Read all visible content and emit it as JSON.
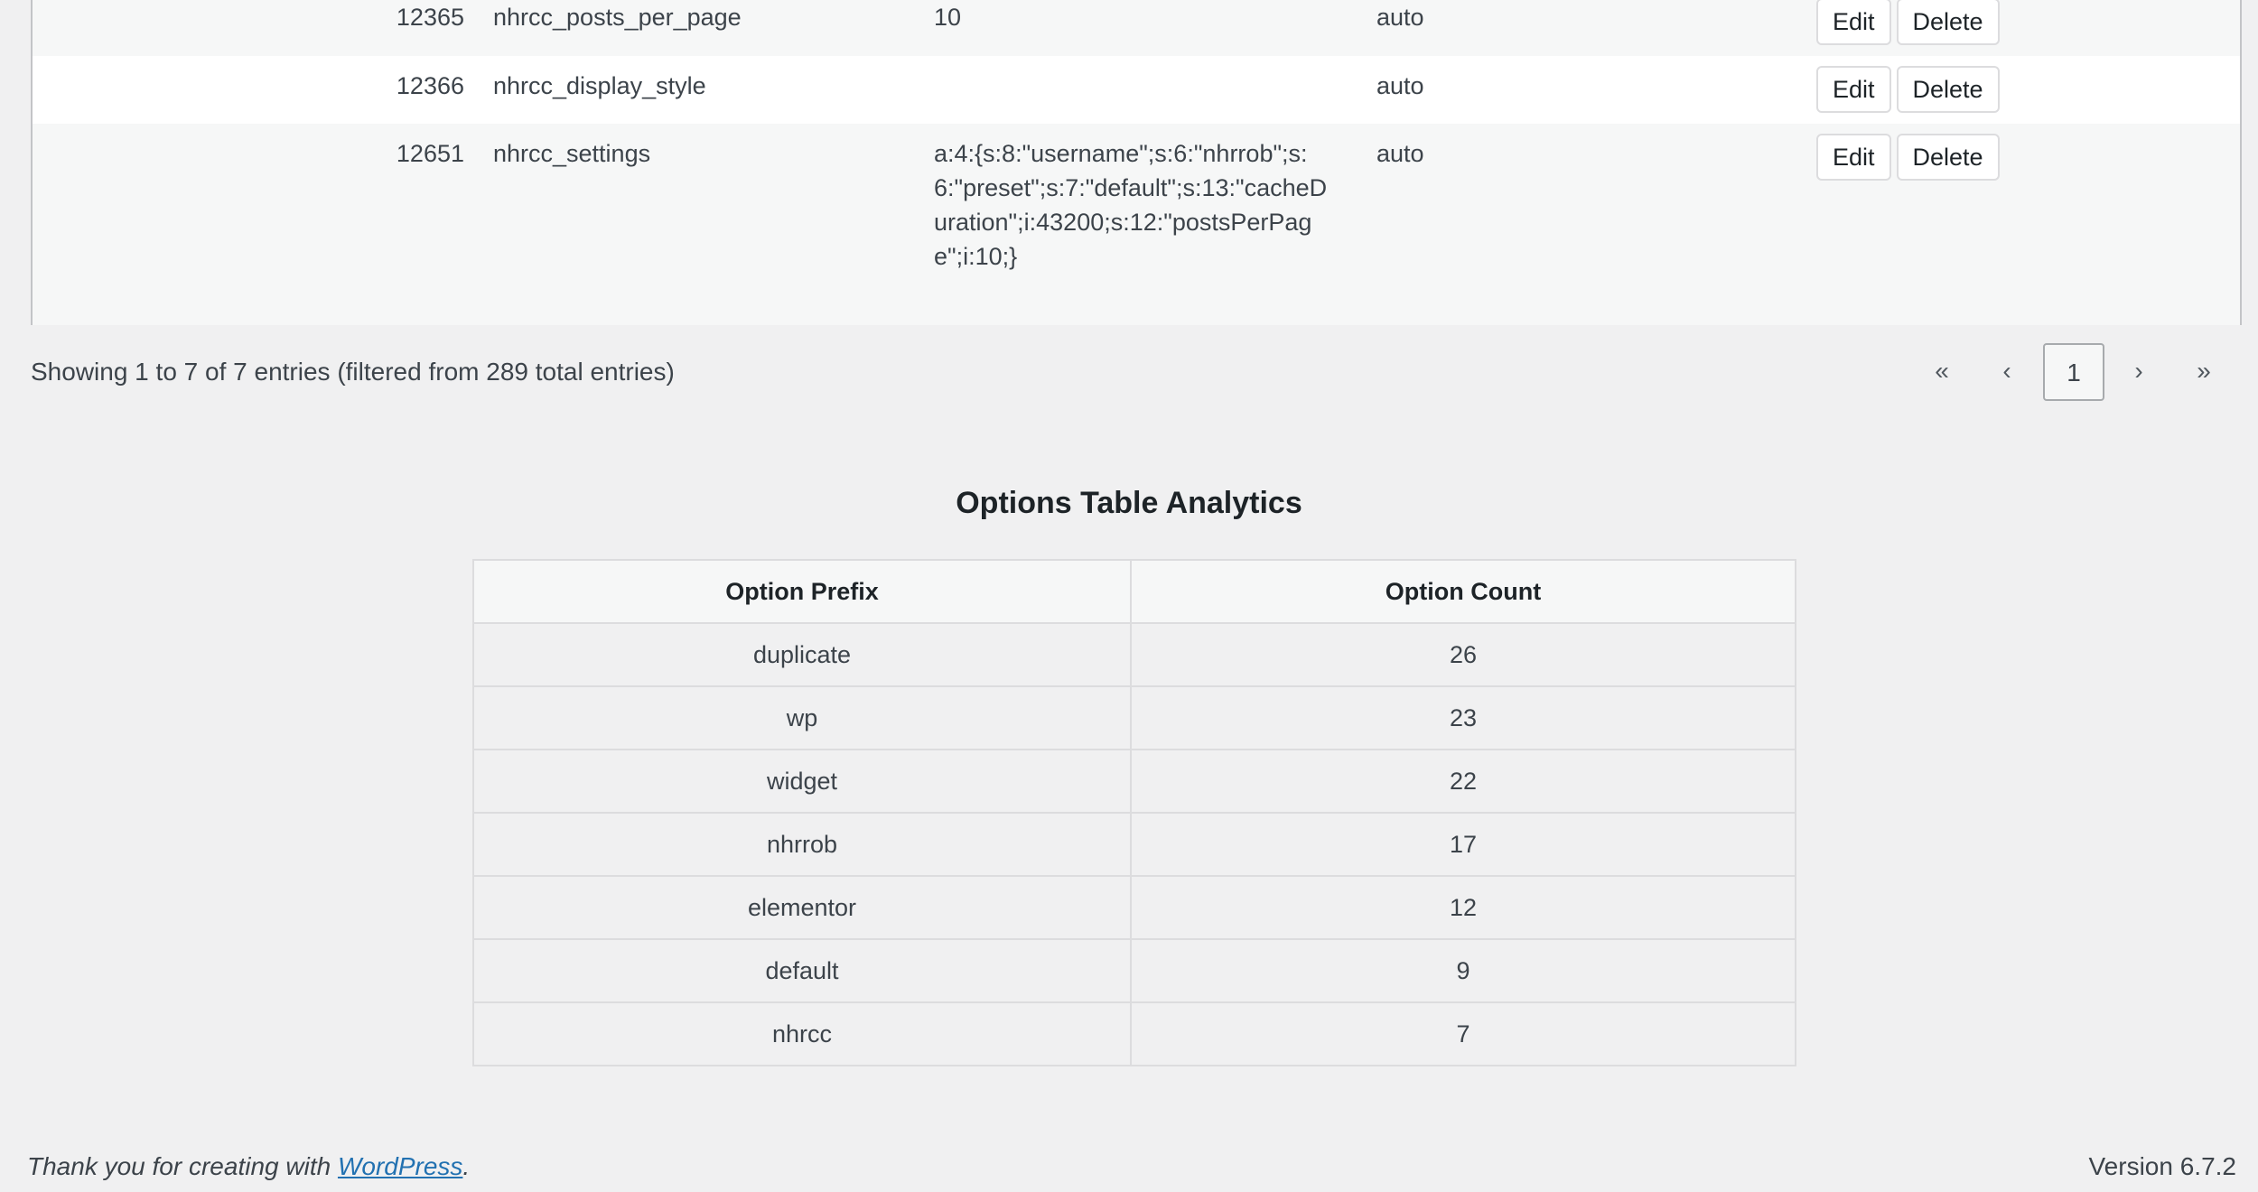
{
  "options_rows": [
    {
      "id": "12365",
      "name": "nhrcc_posts_per_page",
      "value": "10",
      "autoload": "auto",
      "edit": "Edit",
      "delete": "Delete"
    },
    {
      "id": "12366",
      "name": "nhrcc_display_style",
      "value": "",
      "autoload": "auto",
      "edit": "Edit",
      "delete": "Delete"
    },
    {
      "id": "12651",
      "name": "nhrcc_settings",
      "value": "a:4:{s:8:\"username\";s:6:\"nhrrob\";s:6:\"preset\";s:7:\"default\";s:13:\"cacheDuration\";i:43200;s:12:\"postsPerPage\";i:10;}",
      "autoload": "auto",
      "edit": "Edit",
      "delete": "Delete"
    }
  ],
  "table_info": "Showing 1 to 7 of 7 entries (filtered from 289 total entries)",
  "pagination": {
    "first": "«",
    "prev": "‹",
    "current": "1",
    "next": "›",
    "last": "»"
  },
  "analytics": {
    "title": "Options Table Analytics",
    "headers": [
      "Option Prefix",
      "Option Count"
    ],
    "rows": [
      {
        "prefix": "duplicate",
        "count": "26"
      },
      {
        "prefix": "wp",
        "count": "23"
      },
      {
        "prefix": "widget",
        "count": "22"
      },
      {
        "prefix": "nhrrob",
        "count": "17"
      },
      {
        "prefix": "elementor",
        "count": "12"
      },
      {
        "prefix": "default",
        "count": "9"
      },
      {
        "prefix": "nhrcc",
        "count": "7"
      }
    ]
  },
  "footer": {
    "thanks_prefix": "Thank you for creating with ",
    "link_text": "WordPress",
    "thanks_suffix": ".",
    "version": "Version 6.7.2"
  }
}
